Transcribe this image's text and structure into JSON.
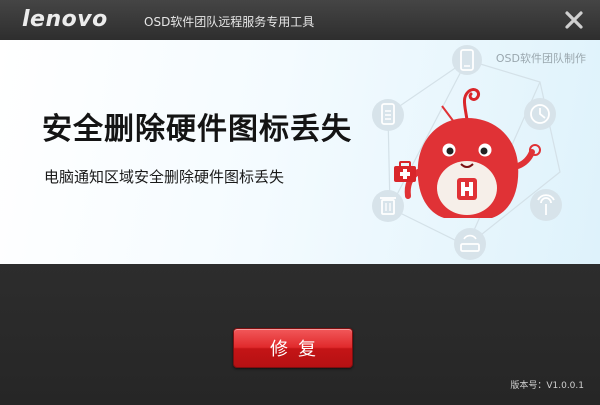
{
  "titlebar": {
    "logo": "lenovo",
    "title": "OSD软件团队远程服务专用工具",
    "close_icon": "close-icon"
  },
  "banner": {
    "credit": "OSD软件团队制作",
    "title": "安全删除硬件图标丢失",
    "subtitle": "电脑通知区域安全删除硬件图标丢失",
    "icons": [
      "mobile-phone-icon",
      "clock-icon",
      "signal-tower-icon",
      "router-icon",
      "trash-icon",
      "battery-icon",
      "first-aid-kit-icon"
    ],
    "mascot": "red-mascot"
  },
  "actions": {
    "repair_label": "修复"
  },
  "footer": {
    "version": "版本号：V1.0.0.1"
  },
  "colors": {
    "titlebar": "#3a3a3a",
    "body": "#2b2b2b",
    "accent_red": "#d9262a",
    "banner_bg": "#eef8fd"
  }
}
